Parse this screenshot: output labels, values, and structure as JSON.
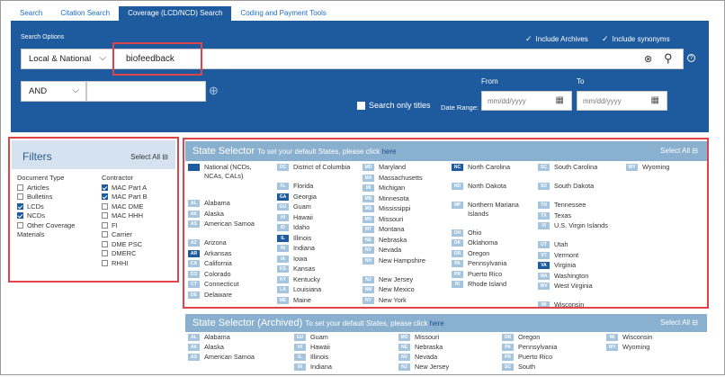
{
  "tabs": [
    "Search",
    "Citation Search",
    "Coverage (LCD/NCD) Search",
    "Coding and Payment Tools"
  ],
  "search": {
    "options_label": "Search Options",
    "include_archives": "Include Archives",
    "include_synonyms": "Include synonyms",
    "scope": "Local & National",
    "query": "biofeedback",
    "operator": "AND",
    "search_only_titles": "Search only titles",
    "date_range_label": "Date Range:",
    "from_label": "From",
    "to_label": "To",
    "from_placeholder": "mm/dd/yyyy",
    "to_placeholder": "mm/dd/yyyy"
  },
  "filters": {
    "title": "Filters",
    "select_all": "Select All",
    "doc_type_label": "Document Type",
    "doc_types": [
      {
        "label": "Articles",
        "checked": false
      },
      {
        "label": "Bulletins",
        "checked": false
      },
      {
        "label": "LCDs",
        "checked": true
      },
      {
        "label": "NCDs",
        "checked": true
      },
      {
        "label": "Other Coverage",
        "checked": false
      }
    ],
    "materials": "Materials",
    "contractor_label": "Contractor",
    "contractors": [
      {
        "label": "MAC Part A",
        "checked": true
      },
      {
        "label": "MAC Part B",
        "checked": true
      },
      {
        "label": "MAC DME",
        "checked": false
      },
      {
        "label": "MAC HHH",
        "checked": false
      },
      {
        "label": "FI",
        "checked": false
      },
      {
        "label": "Carrier",
        "checked": false
      },
      {
        "label": "DME PSC",
        "checked": false
      },
      {
        "label": "DMERC",
        "checked": false
      },
      {
        "label": "RHHI",
        "checked": false
      }
    ]
  },
  "state_selector": {
    "title": "State Selector",
    "subtitle": "To set your default States, please click",
    "link": "here",
    "select_all": "Select All"
  },
  "state_selector_archived": {
    "title": "State Selector (Archived)",
    "subtitle": "To set your default States, please click",
    "link": "here",
    "select_all": "Select All"
  },
  "colors": {
    "brand": "#1e5b9e",
    "highlight": "#e0444a",
    "bar": "#8ab0cf",
    "abbr": "#a5c4de"
  }
}
